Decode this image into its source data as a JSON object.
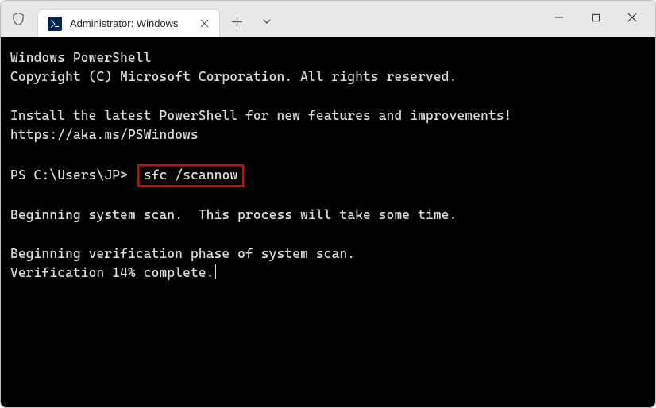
{
  "tab": {
    "title": "Administrator: Windows"
  },
  "terminal": {
    "line1": "Windows PowerShell",
    "line2": "Copyright (C) Microsoft Corporation. All rights reserved.",
    "line3": "Install the latest PowerShell for new features and improvements!",
    "line4": "https://aka.ms/PSWindows",
    "prompt": "PS C:\\Users\\JP>",
    "command": "sfc /scannow",
    "line5": "Beginning system scan.  This process will take some time.",
    "line6": "Beginning verification phase of system scan.",
    "line7": "Verification 14% complete."
  }
}
